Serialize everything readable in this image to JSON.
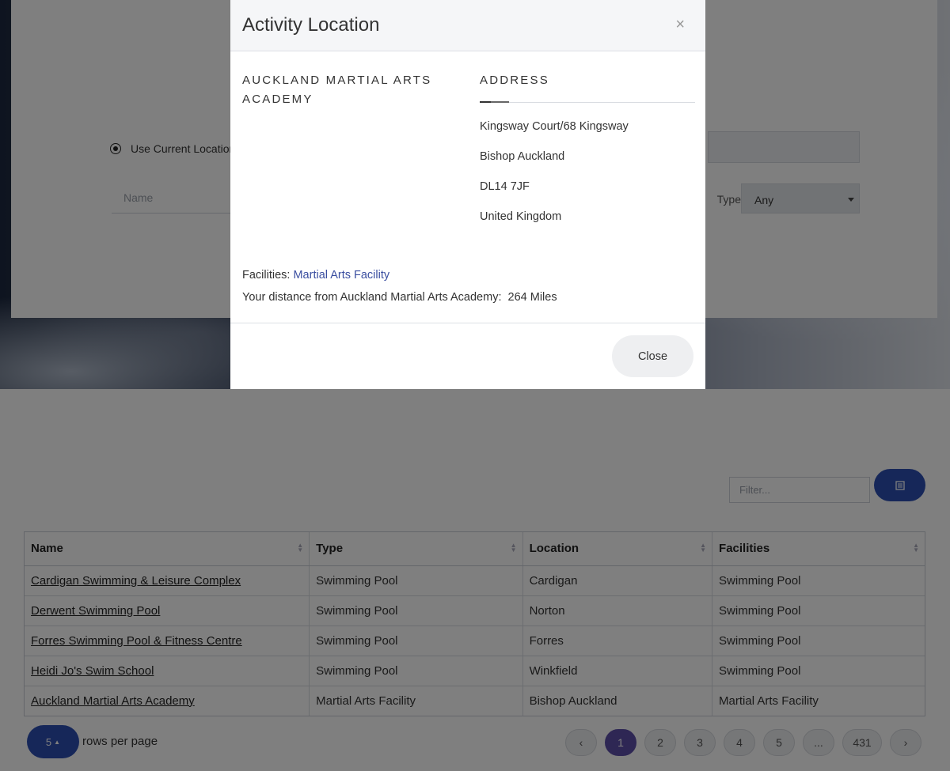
{
  "search_panel": {
    "use_current_location": "Use Current Location",
    "name_placeholder": "Name",
    "type_label": "Type",
    "type_value": "Any"
  },
  "results": {
    "filter_placeholder": "Filter...",
    "columns_icon": "list-icon",
    "headers": [
      "Name",
      "Type",
      "Location",
      "Facilities"
    ],
    "rows": [
      {
        "name": "Cardigan Swimming & Leisure Complex",
        "type": "Swimming Pool",
        "location": "Cardigan",
        "facilities": "Swimming Pool"
      },
      {
        "name": "Derwent Swimming Pool",
        "type": "Swimming Pool",
        "location": "Norton",
        "facilities": "Swimming Pool"
      },
      {
        "name": "Forres Swimming Pool & Fitness Centre",
        "type": "Swimming Pool",
        "location": "Forres",
        "facilities": "Swimming Pool"
      },
      {
        "name": "Heidi Jo's Swim School",
        "type": "Swimming Pool",
        "location": "Winkfield",
        "facilities": "Swimming Pool"
      },
      {
        "name": "Auckland Martial Arts Academy",
        "type": "Martial Arts Facility",
        "location": "Bishop Auckland",
        "facilities": "Martial Arts Facility"
      }
    ],
    "rows_per_page_value": "5",
    "rows_per_page_label": "rows per page",
    "pagination": {
      "prev": "‹",
      "pages": [
        "1",
        "2",
        "3",
        "4",
        "5"
      ],
      "ellipsis": "...",
      "last": "431",
      "next": "›",
      "current": "1"
    }
  },
  "modal": {
    "title": "Activity Location",
    "close_x": "×",
    "venue_name": "AUCKLAND MARTIAL ARTS ACADEMY",
    "address_heading": "ADDRESS",
    "address_lines": [
      "Kingsway Court/68 Kingsway",
      "Bishop Auckland",
      "DL14 7JF",
      "United Kingdom"
    ],
    "facilities_label": "Facilities:",
    "facilities_link": "Martial Arts Facility",
    "distance_text": "Your distance from Auckland Martial Arts Academy:  264 Miles",
    "close_button": "Close"
  }
}
